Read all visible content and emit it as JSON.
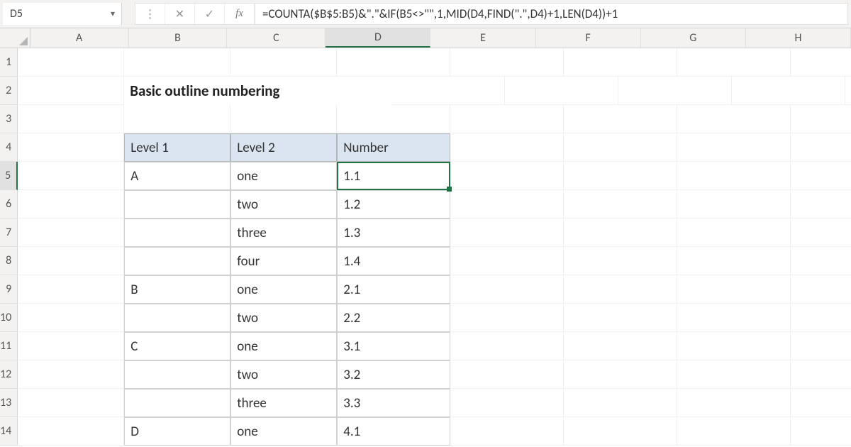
{
  "name_box": {
    "value": "D5"
  },
  "formula_bar": {
    "cancel_glyph": "✕",
    "confirm_glyph": "✓",
    "fx_label": "fx",
    "formula": "=COUNTA($B$5:B5)&\".\"&IF(B5<>\"\",1,MID(D4,FIND(\".\",D4)+1,LEN(D4))+1"
  },
  "columns": [
    "A",
    "B",
    "C",
    "D",
    "E",
    "F",
    "G",
    "H"
  ],
  "rows": [
    "1",
    "2",
    "3",
    "4",
    "5",
    "6",
    "7",
    "8",
    "9",
    "10",
    "11",
    "12",
    "13",
    "14"
  ],
  "active": {
    "row": "5",
    "col": "D"
  },
  "title": "Basic outline numbering",
  "table": {
    "headers": {
      "b": "Level 1",
      "c": "Level 2",
      "d": "Number"
    },
    "rows": [
      {
        "b": "A",
        "c": "one",
        "d": "1.1"
      },
      {
        "b": "",
        "c": "two",
        "d": "1.2"
      },
      {
        "b": "",
        "c": "three",
        "d": "1.3"
      },
      {
        "b": "",
        "c": "four",
        "d": "1.4"
      },
      {
        "b": "B",
        "c": "one",
        "d": "2.1"
      },
      {
        "b": "",
        "c": "two",
        "d": "2.2"
      },
      {
        "b": "C",
        "c": "one",
        "d": "3.1"
      },
      {
        "b": "",
        "c": "two",
        "d": "3.2"
      },
      {
        "b": "",
        "c": "three",
        "d": "3.3"
      },
      {
        "b": "D",
        "c": "one",
        "d": "4.1"
      }
    ]
  }
}
